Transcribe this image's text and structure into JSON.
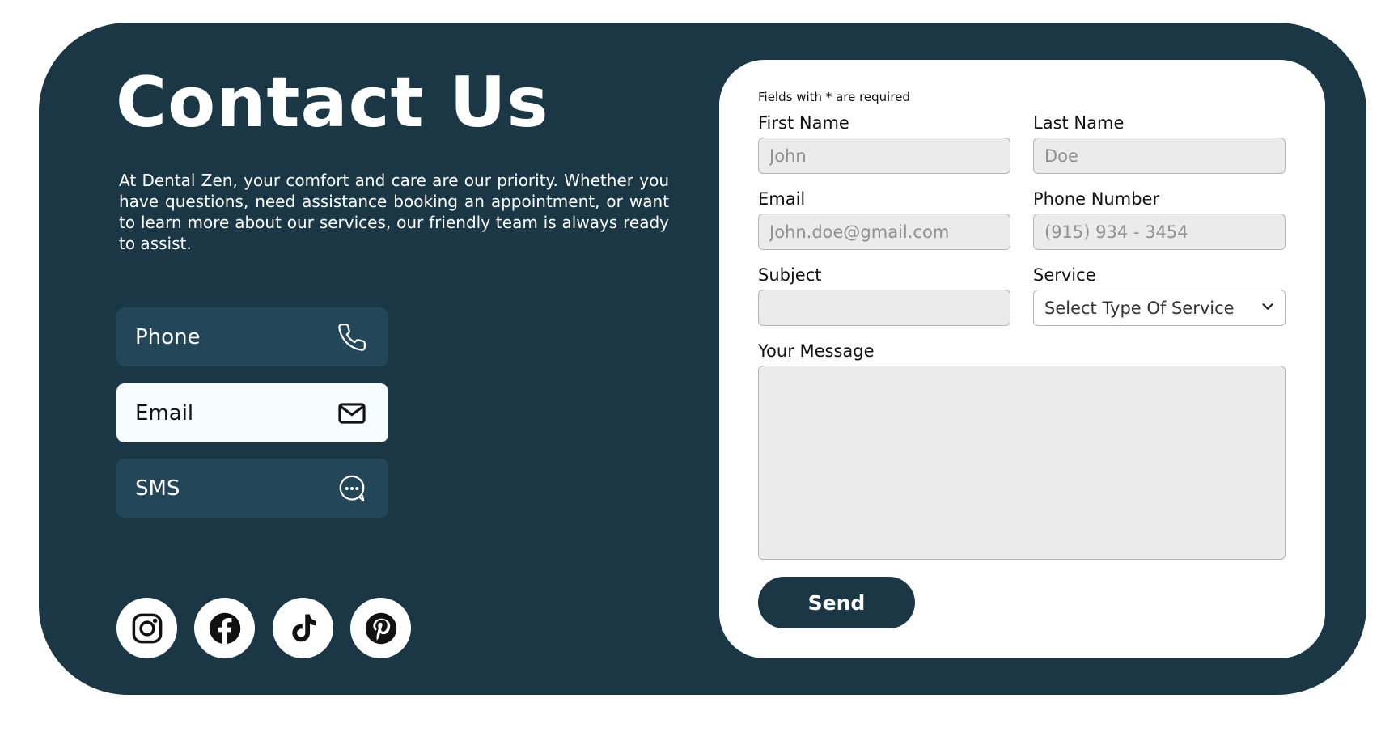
{
  "header": {
    "title": "Contact Us",
    "description": "At Dental Zen, your comfort and care are our priority. Whether you have questions, need assistance booking an appointment, or want to learn more about our services, our friendly team is always ready to assist."
  },
  "contact_methods": [
    {
      "label": "Phone",
      "icon": "phone-icon",
      "selected": false
    },
    {
      "label": "Email",
      "icon": "mail-icon",
      "selected": true
    },
    {
      "label": "SMS",
      "icon": "chat-bubble-icon",
      "selected": false
    }
  ],
  "social": [
    {
      "icon": "instagram-icon"
    },
    {
      "icon": "facebook-icon"
    },
    {
      "icon": "tiktok-icon"
    },
    {
      "icon": "pinterest-icon"
    }
  ],
  "form": {
    "required_note": "Fields with * are required",
    "first_name": {
      "label": "First Name",
      "placeholder": "John",
      "value": ""
    },
    "last_name": {
      "label": "Last Name",
      "placeholder": "Doe",
      "value": ""
    },
    "email": {
      "label": "Email",
      "placeholder": "John.doe@gmail.com",
      "value": ""
    },
    "phone": {
      "label": "Phone Number",
      "placeholder": "(915) 934 - 3454",
      "value": ""
    },
    "subject": {
      "label": "Subject",
      "placeholder": "",
      "value": ""
    },
    "service": {
      "label": "Service",
      "selected": "Select Type Of Service"
    },
    "message": {
      "label": "Your Message",
      "value": ""
    },
    "send_label": "Send"
  },
  "colors": {
    "background": "#1b3644",
    "tile": "#234759",
    "tile_active": "#f7fdfd",
    "field": "#ebebeb",
    "button": "#1b3644"
  }
}
